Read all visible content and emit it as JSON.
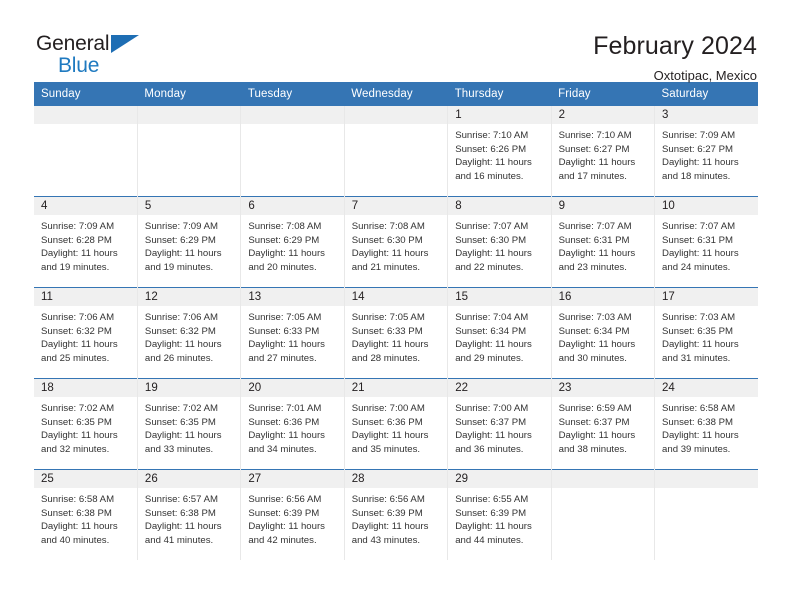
{
  "brand": {
    "name_top": "General",
    "name_bottom": "Blue",
    "flag_icon": "triangle-flag-icon",
    "accent_color": "#1e6eb4"
  },
  "header": {
    "title": "February 2024",
    "subtitle": "Oxtotipac, Mexico"
  },
  "theme": {
    "header_bg": "#3575b4",
    "row_divider": "#3575b4",
    "daynum_band_bg": "#f0f0f0",
    "cell_text": "#333333"
  },
  "calendar": {
    "weekday_headers": [
      "Sunday",
      "Monday",
      "Tuesday",
      "Wednesday",
      "Thursday",
      "Friday",
      "Saturday"
    ],
    "weeks": [
      [
        {
          "day": "",
          "lines": []
        },
        {
          "day": "",
          "lines": []
        },
        {
          "day": "",
          "lines": []
        },
        {
          "day": "",
          "lines": []
        },
        {
          "day": "1",
          "lines": [
            "Sunrise: 7:10 AM",
            "Sunset: 6:26 PM",
            "Daylight: 11 hours",
            "and 16 minutes."
          ]
        },
        {
          "day": "2",
          "lines": [
            "Sunrise: 7:10 AM",
            "Sunset: 6:27 PM",
            "Daylight: 11 hours",
            "and 17 minutes."
          ]
        },
        {
          "day": "3",
          "lines": [
            "Sunrise: 7:09 AM",
            "Sunset: 6:27 PM",
            "Daylight: 11 hours",
            "and 18 minutes."
          ]
        }
      ],
      [
        {
          "day": "4",
          "lines": [
            "Sunrise: 7:09 AM",
            "Sunset: 6:28 PM",
            "Daylight: 11 hours",
            "and 19 minutes."
          ]
        },
        {
          "day": "5",
          "lines": [
            "Sunrise: 7:09 AM",
            "Sunset: 6:29 PM",
            "Daylight: 11 hours",
            "and 19 minutes."
          ]
        },
        {
          "day": "6",
          "lines": [
            "Sunrise: 7:08 AM",
            "Sunset: 6:29 PM",
            "Daylight: 11 hours",
            "and 20 minutes."
          ]
        },
        {
          "day": "7",
          "lines": [
            "Sunrise: 7:08 AM",
            "Sunset: 6:30 PM",
            "Daylight: 11 hours",
            "and 21 minutes."
          ]
        },
        {
          "day": "8",
          "lines": [
            "Sunrise: 7:07 AM",
            "Sunset: 6:30 PM",
            "Daylight: 11 hours",
            "and 22 minutes."
          ]
        },
        {
          "day": "9",
          "lines": [
            "Sunrise: 7:07 AM",
            "Sunset: 6:31 PM",
            "Daylight: 11 hours",
            "and 23 minutes."
          ]
        },
        {
          "day": "10",
          "lines": [
            "Sunrise: 7:07 AM",
            "Sunset: 6:31 PM",
            "Daylight: 11 hours",
            "and 24 minutes."
          ]
        }
      ],
      [
        {
          "day": "11",
          "lines": [
            "Sunrise: 7:06 AM",
            "Sunset: 6:32 PM",
            "Daylight: 11 hours",
            "and 25 minutes."
          ]
        },
        {
          "day": "12",
          "lines": [
            "Sunrise: 7:06 AM",
            "Sunset: 6:32 PM",
            "Daylight: 11 hours",
            "and 26 minutes."
          ]
        },
        {
          "day": "13",
          "lines": [
            "Sunrise: 7:05 AM",
            "Sunset: 6:33 PM",
            "Daylight: 11 hours",
            "and 27 minutes."
          ]
        },
        {
          "day": "14",
          "lines": [
            "Sunrise: 7:05 AM",
            "Sunset: 6:33 PM",
            "Daylight: 11 hours",
            "and 28 minutes."
          ]
        },
        {
          "day": "15",
          "lines": [
            "Sunrise: 7:04 AM",
            "Sunset: 6:34 PM",
            "Daylight: 11 hours",
            "and 29 minutes."
          ]
        },
        {
          "day": "16",
          "lines": [
            "Sunrise: 7:03 AM",
            "Sunset: 6:34 PM",
            "Daylight: 11 hours",
            "and 30 minutes."
          ]
        },
        {
          "day": "17",
          "lines": [
            "Sunrise: 7:03 AM",
            "Sunset: 6:35 PM",
            "Daylight: 11 hours",
            "and 31 minutes."
          ]
        }
      ],
      [
        {
          "day": "18",
          "lines": [
            "Sunrise: 7:02 AM",
            "Sunset: 6:35 PM",
            "Daylight: 11 hours",
            "and 32 minutes."
          ]
        },
        {
          "day": "19",
          "lines": [
            "Sunrise: 7:02 AM",
            "Sunset: 6:35 PM",
            "Daylight: 11 hours",
            "and 33 minutes."
          ]
        },
        {
          "day": "20",
          "lines": [
            "Sunrise: 7:01 AM",
            "Sunset: 6:36 PM",
            "Daylight: 11 hours",
            "and 34 minutes."
          ]
        },
        {
          "day": "21",
          "lines": [
            "Sunrise: 7:00 AM",
            "Sunset: 6:36 PM",
            "Daylight: 11 hours",
            "and 35 minutes."
          ]
        },
        {
          "day": "22",
          "lines": [
            "Sunrise: 7:00 AM",
            "Sunset: 6:37 PM",
            "Daylight: 11 hours",
            "and 36 minutes."
          ]
        },
        {
          "day": "23",
          "lines": [
            "Sunrise: 6:59 AM",
            "Sunset: 6:37 PM",
            "Daylight: 11 hours",
            "and 38 minutes."
          ]
        },
        {
          "day": "24",
          "lines": [
            "Sunrise: 6:58 AM",
            "Sunset: 6:38 PM",
            "Daylight: 11 hours",
            "and 39 minutes."
          ]
        }
      ],
      [
        {
          "day": "25",
          "lines": [
            "Sunrise: 6:58 AM",
            "Sunset: 6:38 PM",
            "Daylight: 11 hours",
            "and 40 minutes."
          ]
        },
        {
          "day": "26",
          "lines": [
            "Sunrise: 6:57 AM",
            "Sunset: 6:38 PM",
            "Daylight: 11 hours",
            "and 41 minutes."
          ]
        },
        {
          "day": "27",
          "lines": [
            "Sunrise: 6:56 AM",
            "Sunset: 6:39 PM",
            "Daylight: 11 hours",
            "and 42 minutes."
          ]
        },
        {
          "day": "28",
          "lines": [
            "Sunrise: 6:56 AM",
            "Sunset: 6:39 PM",
            "Daylight: 11 hours",
            "and 43 minutes."
          ]
        },
        {
          "day": "29",
          "lines": [
            "Sunrise: 6:55 AM",
            "Sunset: 6:39 PM",
            "Daylight: 11 hours",
            "and 44 minutes."
          ]
        },
        {
          "day": "",
          "lines": []
        },
        {
          "day": "",
          "lines": []
        }
      ]
    ]
  }
}
